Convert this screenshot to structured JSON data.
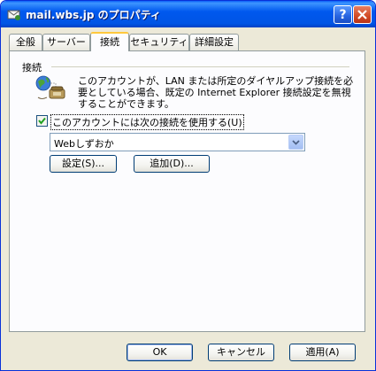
{
  "window": {
    "title": "mail.wbs.jp のプロパティ"
  },
  "tabs": [
    {
      "label": "全般"
    },
    {
      "label": "サーバー"
    },
    {
      "label": "接続"
    },
    {
      "label": "セキュリティ"
    },
    {
      "label": "詳細設定"
    }
  ],
  "connection": {
    "group_label": "接続",
    "description": "このアカウントが、LAN または所定のダイヤルアップ接続を必要としている場合、既定の Internet Explorer 接続設定を無視することができます。",
    "use_connection_label": "このアカウントには次の接続を使用する(U)",
    "use_connection_checked": true,
    "selected_connection": "Webしずおか",
    "settings_button": "設定(S)...",
    "add_button": "追加(D)..."
  },
  "footer": {
    "ok_label": "OK",
    "cancel_label": "キャンセル",
    "apply_label": "適用(A)"
  },
  "icons": {
    "title": "mail-account-icon",
    "help": "help-icon",
    "close": "close-icon",
    "connection": "globe-phone-icon",
    "dropdown": "chevron-down-icon",
    "check": "checkmark-icon"
  },
  "colors": {
    "titlebar": "#0058EE",
    "dialog_bg": "#ECE9D8",
    "active_tab_accent": "#FFC83C",
    "checkbox_check": "#21A121"
  }
}
